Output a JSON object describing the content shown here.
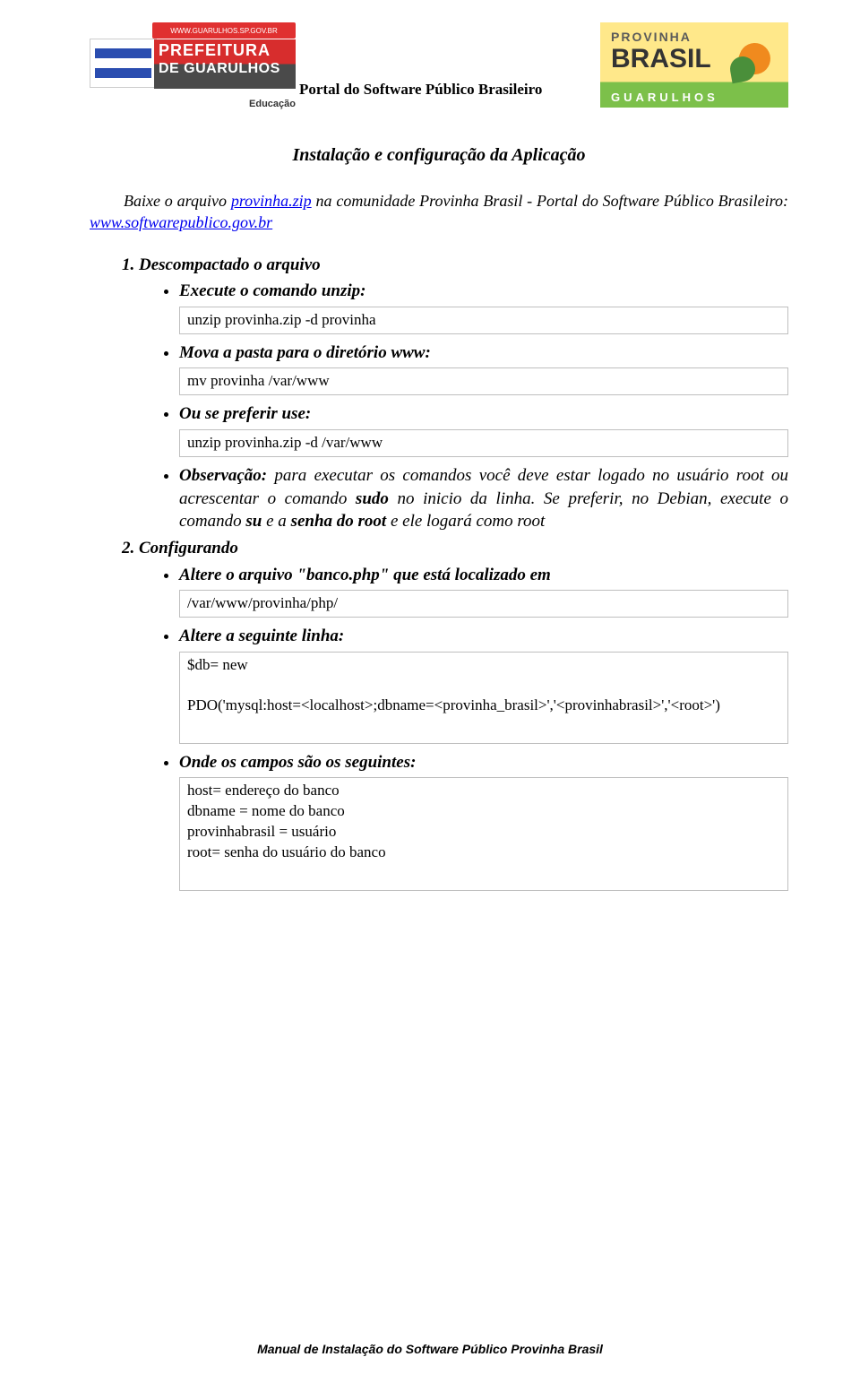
{
  "header": {
    "left_logo": {
      "url_text": "WWW.GUARULHOS.SP.GOV.BR",
      "line1": "PREFEITURA",
      "line2": "DE GUARULHOS",
      "department": "Educação"
    },
    "center_title": "Portal do Software Público Brasileiro",
    "right_logo": {
      "line1": "PROVINHA",
      "line2": "BRASIL",
      "line3": "GUARULHOS"
    }
  },
  "doc_title": "Instalação e configuração da Aplicação",
  "intro": {
    "pre": "Baixe o arquivo ",
    "link1": "provinha.zip",
    "mid": " na comunidade Provinha Brasil - Portal do Software Público Brasileiro: ",
    "link2": "www.softwarepublico.gov.br"
  },
  "s1": {
    "title": "Descompactado o arquivo",
    "i1": "Execute o comando unzip:",
    "c1": "unzip provinha.zip -d provinha",
    "i2": "Mova a pasta para o diretório www:",
    "c2": "mv provinha  /var/www",
    "i3": "Ou se preferir use:",
    "c3": "unzip provinha.zip -d   /var/www",
    "obs_label": "Observação:",
    "obs_a": " para executar os comandos você deve estar logado no usuário root ou acrescentar o comando ",
    "obs_sudo": "sudo",
    "obs_b": " no inicio da linha. Se preferir, no Debian, execute o comando ",
    "obs_su": "su",
    "obs_c": " e a ",
    "obs_senha": "senha do root",
    "obs_d": " e ele logará como root"
  },
  "s2": {
    "title": "Configurando",
    "i1": "Altere o arquivo \"banco.php\" que está  localizado em",
    "c1": "/var/www/provinha/php/",
    "i2": "Altere a seguinte linha:",
    "c2a": "$db= new",
    "c2b": "PDO('mysql:host=<localhost>;dbname=<provinha_brasil>','<provinhabrasil>','<root>')",
    "i3": "Onde os campos são os seguintes:",
    "c3": "host= endereço do banco\ndbname = nome do banco\nprovinhabrasil = usuário\nroot= senha do usuário do banco"
  },
  "footer": "Manual de Instalação do Software Público Provinha Brasil"
}
